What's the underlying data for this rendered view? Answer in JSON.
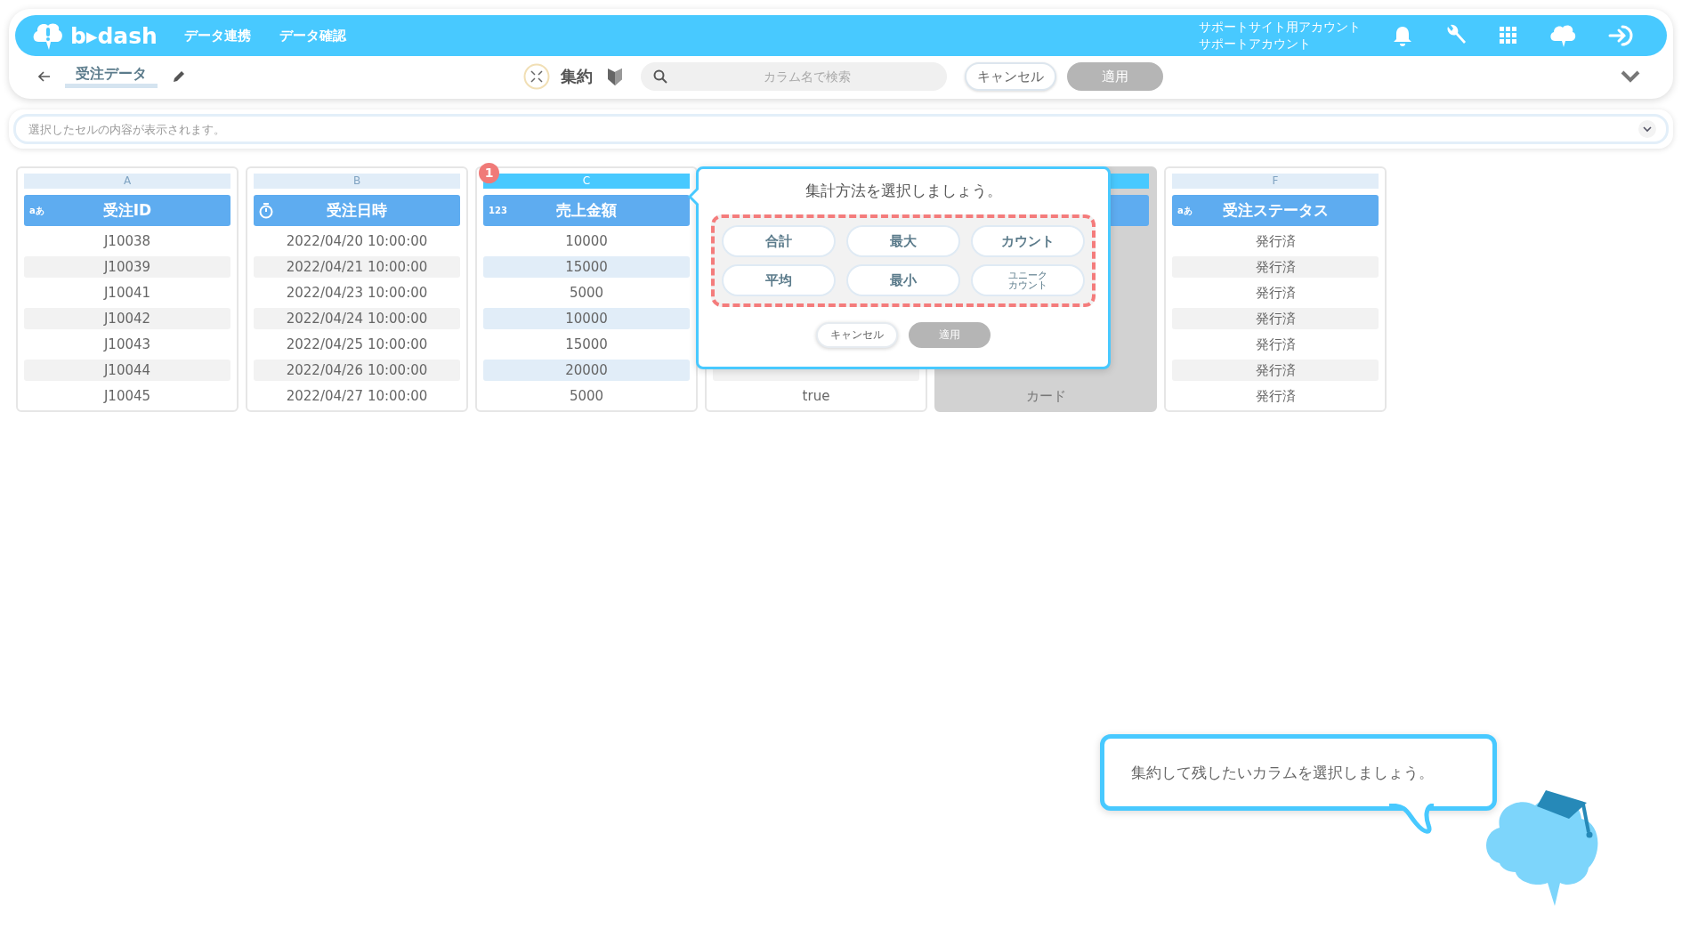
{
  "header": {
    "logo": "b▸dash",
    "nav": [
      "データ連携",
      "データ確認"
    ],
    "account": [
      "サポートサイト用アカウント",
      "サポートアカウント"
    ]
  },
  "toolbar": {
    "title": "受注データ",
    "mode": "集約",
    "search": {
      "placeholder": "カラム名で検索"
    },
    "buttons": [
      {
        "label": "キャンセル",
        "disabled": false
      },
      {
        "label": "適用",
        "disabled": true
      }
    ]
  },
  "cell_bar": {
    "placeholder": "選択したセルの内容が表示されます。"
  },
  "columns": [
    {
      "letter": "A",
      "name": "受注ID",
      "kind": "text",
      "type_label": "aあ",
      "selected": false,
      "disabled": false,
      "rows": [
        "J10038",
        "J10039",
        "J10041",
        "J10042",
        "J10043",
        "J10044",
        "J10045"
      ]
    },
    {
      "letter": "B",
      "name": "受注日時",
      "kind": "datetime",
      "selected": false,
      "disabled": false,
      "rows": [
        "2022/04/20 10:00:00",
        "2022/04/21 10:00:00",
        "2022/04/23 10:00:00",
        "2022/04/24 10:00:00",
        "2022/04/25 10:00:00",
        "2022/04/26 10:00:00",
        "2022/04/27 10:00:00"
      ]
    },
    {
      "letter": "C",
      "name": "売上金額",
      "kind": "number",
      "type_label": "123",
      "selected": true,
      "disabled": false,
      "badge": "1",
      "rows": [
        "10000",
        "15000",
        "5000",
        "10000",
        "15000",
        "20000",
        "5000"
      ]
    },
    {
      "disabled": false,
      "rows": [
        null,
        null,
        null,
        null,
        null,
        null,
        "true"
      ]
    },
    {
      "selected": true,
      "disabled": true,
      "rows": [
        null,
        null,
        null,
        null,
        null,
        null,
        "カード"
      ]
    },
    {
      "letter": "F",
      "name": "受注ステータス",
      "kind": "text",
      "type_label": "aあ",
      "selected": false,
      "disabled": false,
      "rows": [
        "発行済",
        "発行済",
        "発行済",
        "発行済",
        "発行済",
        "発行済",
        "発行済"
      ]
    }
  ],
  "popup": {
    "title": "集計方法を選択しましょう。",
    "options": [
      "合計",
      "最大",
      "カウント",
      "平均",
      "最小",
      "ユニークカウント"
    ],
    "buttons": [
      {
        "label": "キャンセル",
        "disabled": false
      },
      {
        "label": "適用",
        "disabled": true
      }
    ]
  },
  "guide": {
    "message": "集約して残したいカラムを選択しましょう。"
  }
}
